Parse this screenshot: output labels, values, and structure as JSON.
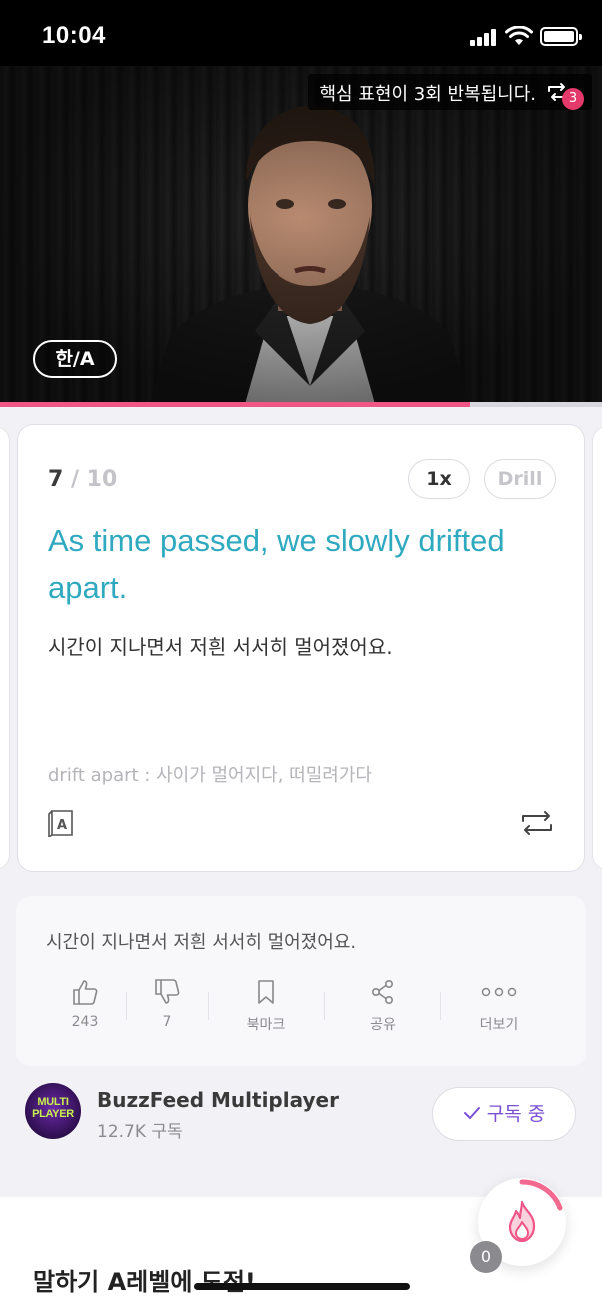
{
  "status_bar": {
    "time": "10:04"
  },
  "video": {
    "repeat_banner": "핵심 표현이 3회 반복됩니다.",
    "repeat_count": "3",
    "lang_toggle": "한/A",
    "progress": 0.78
  },
  "card": {
    "current": "7",
    "separator": " / ",
    "total": "10",
    "speed": "1x",
    "drill": "Drill",
    "sentence_en": "As time passed, we slowly drifted apart.",
    "sentence_ko": "시간이 지나면서 저흰 서서히 멀어졌어요.",
    "vocab": "drift apart : 사이가 멀어지다, 떠밀려가다",
    "dict_icon_letter": "A"
  },
  "actions": {
    "caption": "시간이 지나면서 저흰 서서히 멀어졌어요.",
    "items": [
      {
        "icon": "thumbs-up-icon",
        "label": "243"
      },
      {
        "icon": "thumbs-down-icon",
        "label": "7"
      },
      {
        "icon": "bookmark-icon",
        "label": "북마크"
      },
      {
        "icon": "share-icon",
        "label": "공유"
      },
      {
        "icon": "more-icon",
        "label": "더보기"
      }
    ]
  },
  "channel": {
    "avatar_text_1": "MULTI",
    "avatar_text_2": "PLAYER",
    "name": "BuzzFeed Multiplayer",
    "subscribers": "12.7K 구독",
    "subscribe_label": "구독 중"
  },
  "bottom": {
    "title": "말하기 A레벨에 도전!",
    "fab_count": "0"
  },
  "colors": {
    "accent_teal": "#2ea9bf",
    "progress_pink": "#ef5587",
    "subscribe_purple": "#7b4fd6",
    "badge_pink": "#e4396b"
  }
}
